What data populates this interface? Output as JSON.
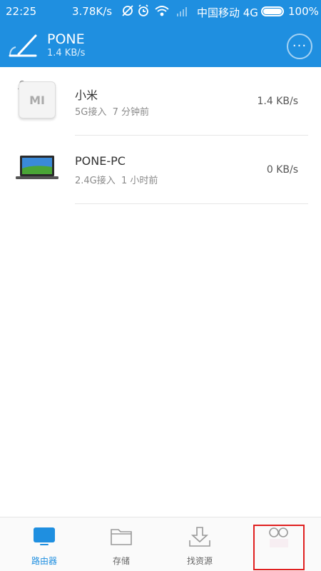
{
  "status_bar": {
    "time": "22:25",
    "network_speed": "3.78K/s",
    "carrier": "中国移动 4G",
    "battery": "100%"
  },
  "router": {
    "name": "PONE",
    "speed": "1.4 KB/s",
    "icon": "router-gauge-icon",
    "more_icon": "more-icon",
    "more_label": "···"
  },
  "devices": [
    {
      "name": "小米",
      "connection": "5G接入",
      "last_seen": "7 分钟前",
      "speed": "1.4 KB/s",
      "icon": "xiaomi-logo-icon",
      "logo_text": "MI"
    },
    {
      "name": "PONE-PC",
      "connection": "2.4G接入",
      "last_seen": "1 小时前",
      "speed": "0 KB/s",
      "icon": "laptop-icon"
    }
  ],
  "bottom_nav": {
    "items": [
      {
        "label": "路由器",
        "icon": "router-tv-icon",
        "active": true
      },
      {
        "label": "存储",
        "icon": "folder-icon",
        "active": false
      },
      {
        "label": "找资源",
        "icon": "download-icon",
        "active": false
      },
      {
        "label": "",
        "icon": "profile-icon",
        "active": false
      }
    ]
  },
  "colors": {
    "accent": "#1f8fe0",
    "highlight_box": "#e02020"
  }
}
